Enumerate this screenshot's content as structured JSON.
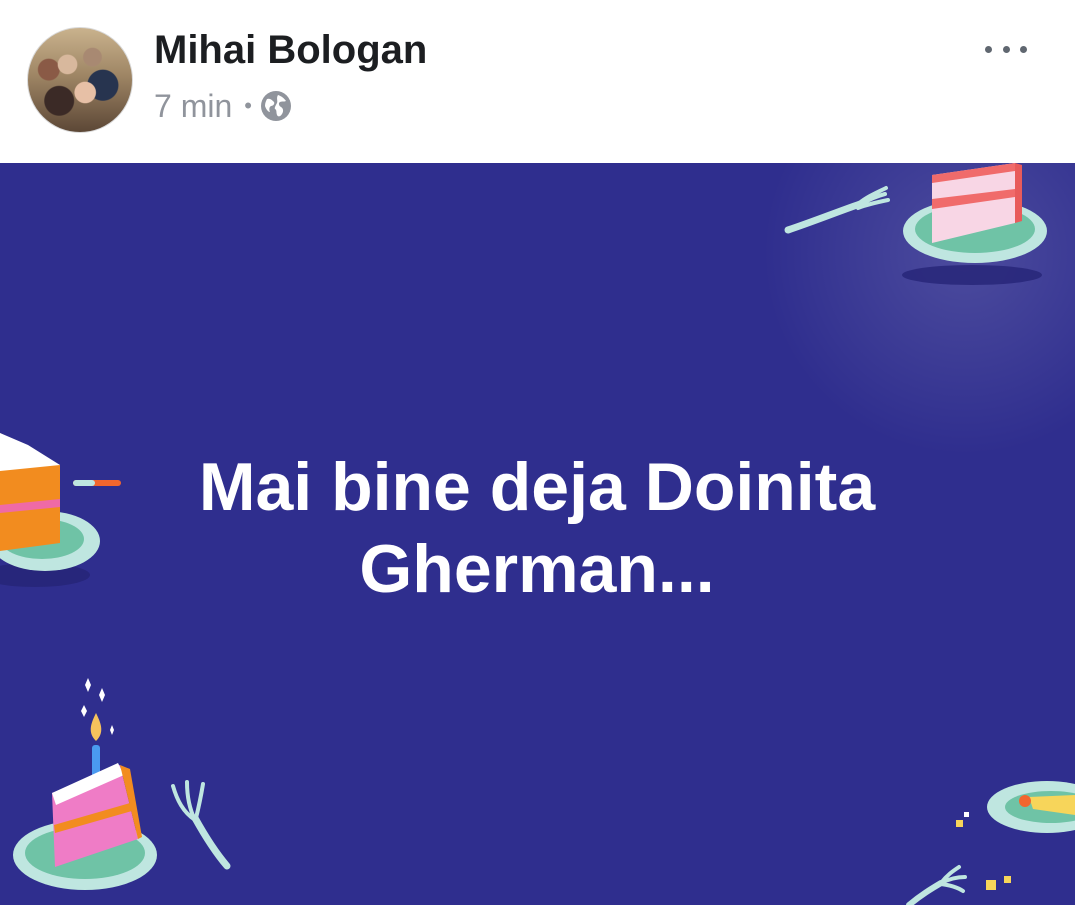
{
  "post": {
    "author": "Mihai Bologan",
    "time": "7 min",
    "separator": "•",
    "audience_icon": "globe-icon",
    "menu_icon": "more-options-icon",
    "text": "Mai bine deja Doinita Gherman...",
    "background": {
      "color": "#2f2e8e",
      "theme": "birthday cake slices",
      "decorations": [
        "cake-slice-icon",
        "fork-icon",
        "candle-icon"
      ]
    }
  }
}
